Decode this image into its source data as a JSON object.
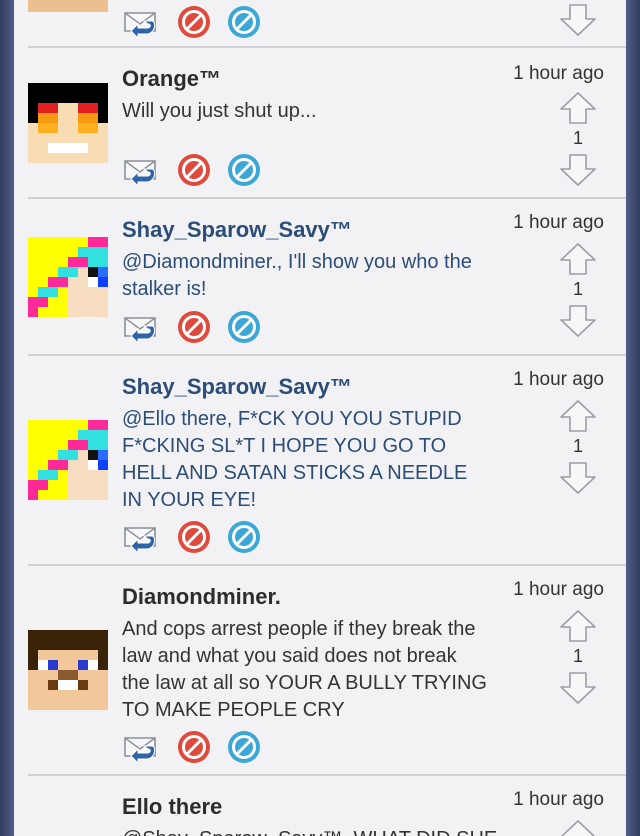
{
  "posts": [
    {
      "name": "Orange™",
      "time": "1 hour ago",
      "lines": [
        "Will you just shut up..."
      ],
      "votes": "1"
    },
    {
      "name": "Shay_Sparow_Savy™",
      "time": "1 hour ago",
      "lines": [
        "@Diamondminer., I'll show you who the",
        "stalker is!"
      ],
      "votes": "1"
    },
    {
      "name": "Shay_Sparow_Savy™",
      "time": "1 hour ago",
      "lines": [
        "@Ello there, F*CK YOU YOU STUPID",
        "F*CKING SL*T I HOPE YOU GO TO",
        "HELL AND SATAN STICKS A NEEDLE",
        "IN YOUR EYE!"
      ],
      "votes": "1"
    },
    {
      "name": "Diamondminer.",
      "time": "1 hour ago",
      "lines": [
        "And cops arrest people if they break the",
        "law and what you said does not break",
        "the law at all so YOUR A BULLY TRYING",
        "TO MAKE PEOPLE CRY"
      ],
      "votes": "1"
    },
    {
      "name": "Ello there",
      "time": "1 hour ago",
      "lines": [
        "@Shay_Sparow_Savy™, WHAT DID SHE"
      ],
      "votes": ""
    }
  ],
  "icons": {
    "reply": "reply-icon",
    "flag": "flag-icon",
    "block": "block-icon",
    "upvote": "upvote-arrow-icon",
    "downvote": "downvote-arrow-icon"
  },
  "colors": {
    "accent_blue": "#2b4d77",
    "flag_red": "#e04a3c",
    "block_blue": "#3aa7d6"
  }
}
